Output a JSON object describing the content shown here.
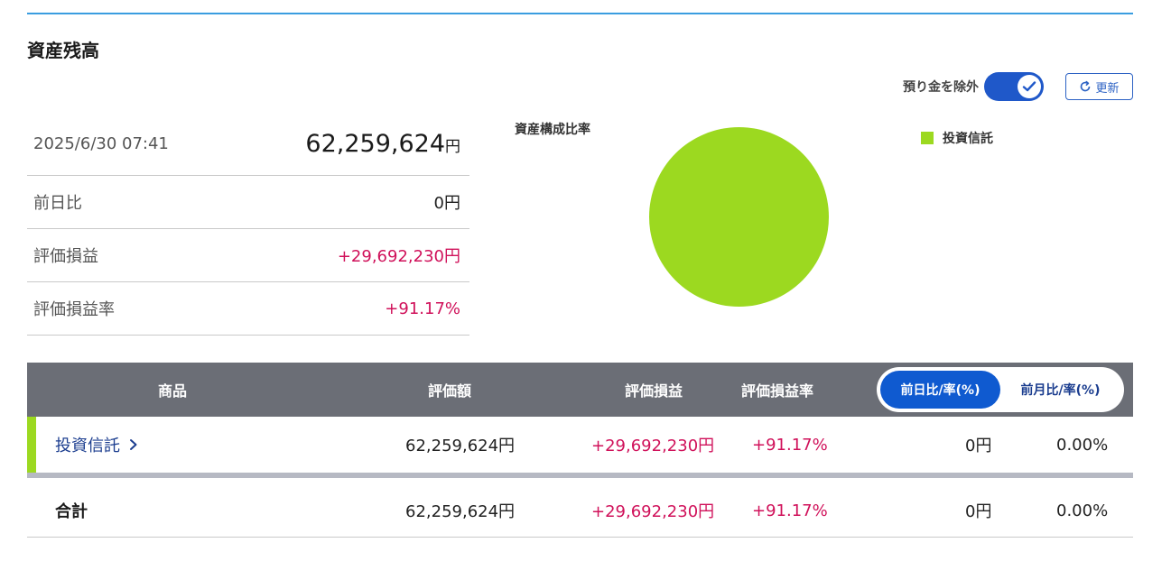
{
  "page": {
    "title": "資産残高"
  },
  "controls": {
    "exclude_deposit_label": "預り金を除外",
    "exclude_deposit_on": true,
    "refresh_label": "更新"
  },
  "summary": {
    "timestamp": "2025/6/30 07:41",
    "total_value": "62,259,624",
    "total_unit": "円",
    "rows": [
      {
        "label": "前日比",
        "value": "0円"
      },
      {
        "label": "評価損益",
        "value": "+29,692,230円"
      },
      {
        "label": "評価損益率",
        "value": "+91.17%"
      }
    ]
  },
  "chart_data": {
    "type": "pie",
    "title": "資産構成比率",
    "categories": [
      "投資信託"
    ],
    "values": [
      100
    ],
    "colors": [
      "#9cd920"
    ],
    "legend": "top-right"
  },
  "table": {
    "headers": {
      "product": "商品",
      "value": "評価額",
      "pl": "評価損益",
      "pl_rate": "評価損益率"
    },
    "toggle": {
      "day": "前日比/率(%)",
      "month": "前月比/率(%)",
      "active": "day"
    },
    "rows": [
      {
        "name": "投資信託",
        "value": "62,259,624円",
        "pl": "+29,692,230円",
        "pl_rate": "+91.17%",
        "change": "0円",
        "change_rate": "0.00%"
      }
    ],
    "total": {
      "name": "合計",
      "value": "62,259,624円",
      "pl": "+29,692,230円",
      "pl_rate": "+91.17%",
      "change": "0円",
      "change_rate": "0.00%"
    }
  },
  "colors": {
    "accent": "#1f58c9",
    "positive": "#d0115a",
    "fund": "#9cd920",
    "header_bg": "#6b6e76"
  }
}
